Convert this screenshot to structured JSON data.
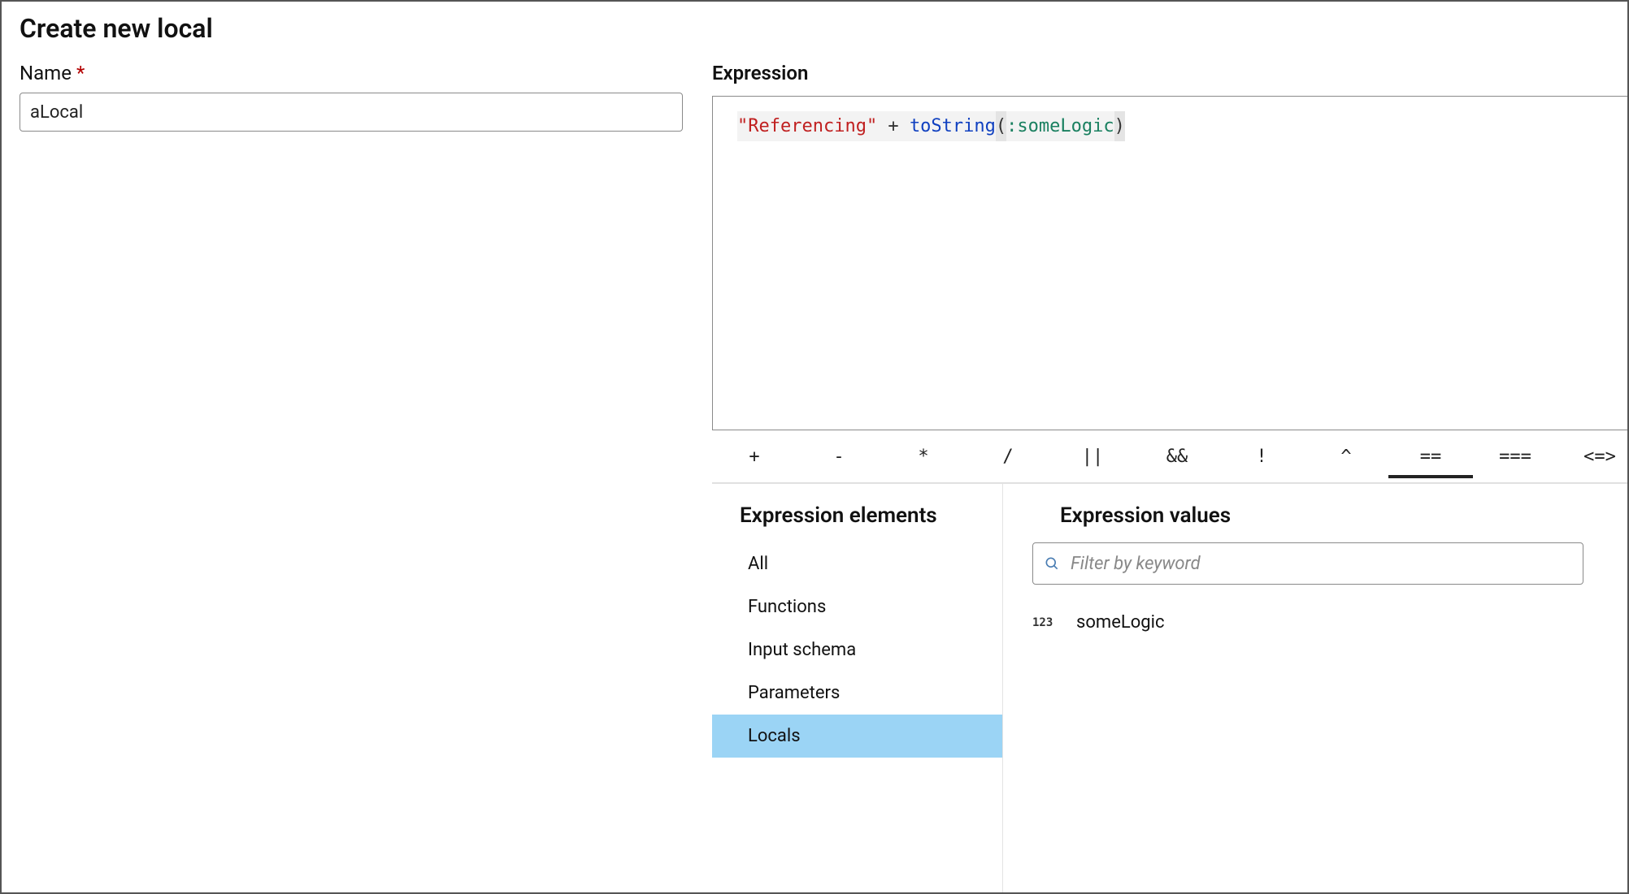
{
  "dialog": {
    "title": "Create new local",
    "name_label": "Name",
    "name_required_mark": "*",
    "name_value": "aLocal",
    "expression_label": "Expression"
  },
  "code": {
    "string_literal": "\"Referencing\"",
    "op_plus": " + ",
    "func": "toString",
    "lparen": "(",
    "param": ":someLogic",
    "rparen": ")"
  },
  "operators": [
    {
      "id": "plus",
      "label": "+"
    },
    {
      "id": "minus",
      "label": "-"
    },
    {
      "id": "mult",
      "label": "*"
    },
    {
      "id": "div",
      "label": "/"
    },
    {
      "id": "or",
      "label": "||"
    },
    {
      "id": "and",
      "label": "&&"
    },
    {
      "id": "not",
      "label": "!"
    },
    {
      "id": "xor",
      "label": "^"
    },
    {
      "id": "eq",
      "label": "==",
      "active": true
    },
    {
      "id": "seq",
      "label": "==="
    },
    {
      "id": "cmp",
      "label": "<=>"
    }
  ],
  "elements": {
    "title": "Expression elements",
    "items": [
      {
        "id": "all",
        "label": "All"
      },
      {
        "id": "functions",
        "label": "Functions"
      },
      {
        "id": "input",
        "label": "Input schema"
      },
      {
        "id": "parameters",
        "label": "Parameters"
      },
      {
        "id": "locals",
        "label": "Locals",
        "selected": true
      }
    ]
  },
  "values": {
    "title": "Expression values",
    "filter_placeholder": "Filter by keyword",
    "items": [
      {
        "type_badge": "123",
        "name": "someLogic"
      }
    ]
  }
}
